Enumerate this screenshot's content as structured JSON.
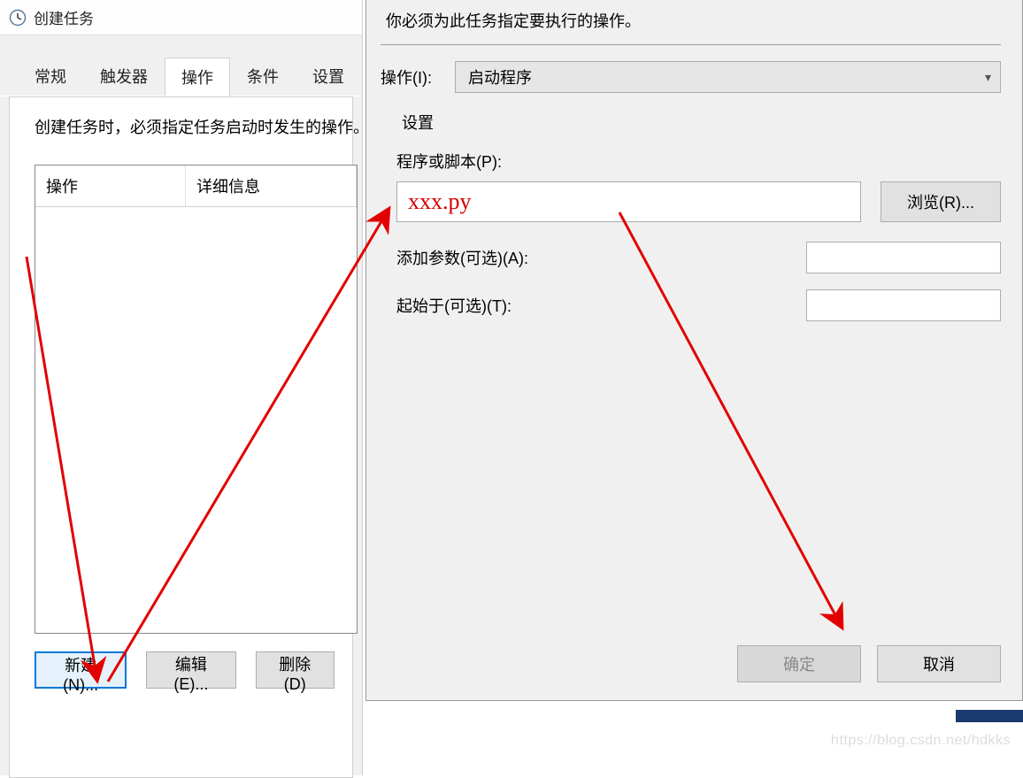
{
  "leftWindow": {
    "title": "创建任务",
    "tabs": [
      "常规",
      "触发器",
      "操作",
      "条件",
      "设置"
    ],
    "activeTab": 2,
    "hint": "创建任务时，必须指定任务启动时发生的操作。",
    "columns": {
      "c1": "操作",
      "c2": "详细信息"
    },
    "buttons": {
      "new": "新建(N)...",
      "edit": "编辑(E)...",
      "delete": "删除(D)"
    }
  },
  "dialog": {
    "instruction": "你必须为此任务指定要执行的操作。",
    "actionLabel": "操作(I):",
    "actionValue": "启动程序",
    "settingsLabel": "设置",
    "programLabel": "程序或脚本(P):",
    "programValue": "xxx.py",
    "browse": "浏览(R)...",
    "argsLabel": "添加参数(可选)(A):",
    "argsValue": "",
    "startInLabel": "起始于(可选)(T):",
    "startInValue": "",
    "ok": "确定",
    "cancel": "取消"
  },
  "watermark": "https://blog.csdn.net/hdkks"
}
